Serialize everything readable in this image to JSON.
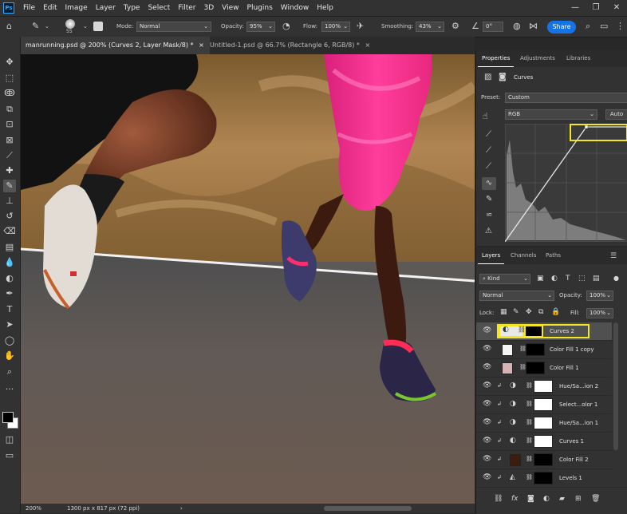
{
  "app": {
    "logo_text": "Ps"
  },
  "menu": [
    "File",
    "Edit",
    "Image",
    "Layer",
    "Type",
    "Select",
    "Filter",
    "3D",
    "View",
    "Plugins",
    "Window",
    "Help"
  ],
  "window_controls": {
    "minimize": "—",
    "restore": "❐",
    "close": "✕"
  },
  "options_bar": {
    "brush_size": "55",
    "mode_label": "Mode:",
    "mode_value": "Normal",
    "opacity_label": "Opacity:",
    "opacity_value": "95%",
    "flow_label": "Flow:",
    "flow_value": "100%",
    "smoothing_label": "Smoothing:",
    "smoothing_value": "43%",
    "angle_value": "0°",
    "share_label": "Share"
  },
  "tabs": [
    {
      "label": "manrunning.psd @ 200% (Curves 2, Layer Mask/8) *",
      "close": "×"
    },
    {
      "label": "Untitled-1.psd @ 66.7% (Rectangle 6, RGB/8) *",
      "close": "×"
    }
  ],
  "status": {
    "zoom": "200%",
    "doc_size": "1300 px x 817 px (72 ppi)"
  },
  "properties": {
    "tabs": [
      "Properties",
      "Adjustments",
      "Libraries"
    ],
    "header": "Curves",
    "preset_label": "Preset:",
    "preset_value": "Custom",
    "channel_value": "RGB",
    "auto_label": "Auto"
  },
  "layers_panel": {
    "tabs": [
      "Layers",
      "Channels",
      "Paths"
    ],
    "kind_label": "Kind",
    "blend_mode": "Normal",
    "opacity_label": "Opacity:",
    "opacity_value": "100%",
    "lock_label": "Lock:",
    "fill_label": "Fill:",
    "fill_value": "100%",
    "layers": [
      {
        "name": "Curves 2"
      },
      {
        "name": "Color Fill 1 copy"
      },
      {
        "name": "Color Fill 1"
      },
      {
        "name": "Hue/Sa...ion 2"
      },
      {
        "name": "Select...olor 1"
      },
      {
        "name": "Hue/Sa...ion 1"
      },
      {
        "name": "Curves 1"
      },
      {
        "name": "Color Fill 2"
      },
      {
        "name": "Levels 1"
      }
    ],
    "footer_fx": "fx"
  },
  "colors": {
    "accent_blue": "#1473e6",
    "highlight_yellow": "#f5e71f",
    "pink_tights": "#ff2d8a",
    "fill_swatch_pink": "#d9b4b4",
    "fill_swatch_brown": "#3a1d0e"
  }
}
